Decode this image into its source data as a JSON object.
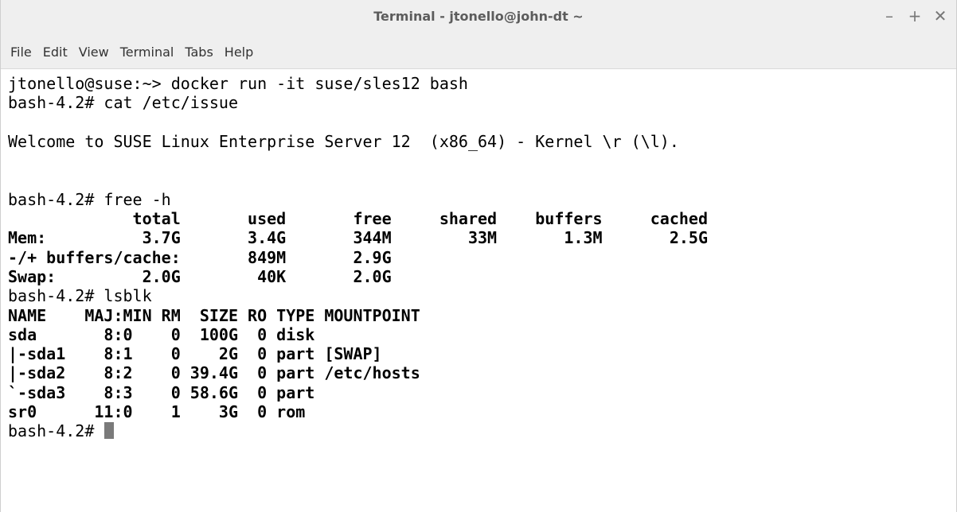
{
  "window": {
    "title": "Terminal - jtonello@john-dt ~",
    "controls": {
      "minimize": "–",
      "maximize": "+",
      "close": "✕"
    }
  },
  "menu": {
    "items": [
      "File",
      "Edit",
      "View",
      "Terminal",
      "Tabs",
      "Help"
    ]
  },
  "terminal": {
    "cursor_color": "#7a7a7a",
    "lines": [
      "jtonello@suse:~> docker run -it suse/sles12 bash",
      "bash-4.2# cat /etc/issue",
      "",
      "Welcome to SUSE Linux Enterprise Server 12  (x86_64) - Kernel \\r (\\l).",
      "",
      "",
      "bash-4.2# free -h",
      "             total       used       free     shared    buffers     cached",
      "Mem:          3.7G       3.4G       344M        33M       1.3M       2.5G",
      "-/+ buffers/cache:       849M       2.9G",
      "Swap:         2.0G        40K       2.0G",
      "bash-4.2# lsblk",
      "NAME    MAJ:MIN RM  SIZE RO TYPE MOUNTPOINT",
      "sda       8:0    0  100G  0 disk",
      "|-sda1    8:1    0    2G  0 part [SWAP]",
      "|-sda2    8:2    0 39.4G  0 part /etc/hosts",
      "`-sda3    8:3    0 58.6G  0 part",
      "sr0      11:0    1    3G  0 rom",
      "bash-4.2# "
    ]
  }
}
